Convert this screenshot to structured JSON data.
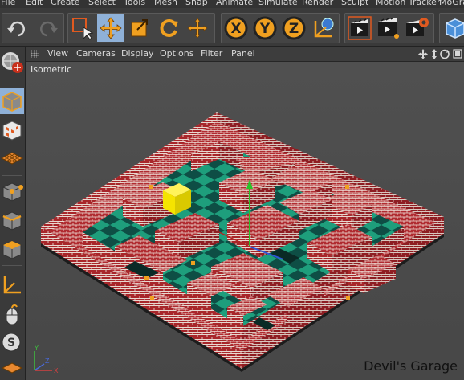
{
  "menubar": {
    "items": [
      "File",
      "Edit",
      "Create",
      "Select",
      "Tools",
      "Mesh",
      "Snap",
      "Animate",
      "Simulate",
      "Render",
      "Sculpt",
      "Motion Tracker",
      "MoGraph"
    ]
  },
  "toolbar": {
    "buttons": [
      "undo-icon",
      "redo-icon",
      "live-selection-icon",
      "move-icon",
      "scale-icon",
      "rotate-icon",
      "recent-tools-icon",
      "x-axis-lock-icon",
      "y-axis-lock-icon",
      "z-axis-lock-icon",
      "coordinate-system-icon",
      "render-view-icon",
      "render-to-picture-viewer-icon",
      "render-settings-icon",
      "cube-object-icon"
    ],
    "x_label": "X",
    "y_label": "Y",
    "z_label": "Z",
    "selected": "move-icon"
  },
  "left_palette": {
    "buttons": [
      "make-editable-icon",
      "model-mode-icon",
      "texture-mode-icon",
      "workplane-mode-icon",
      "points-mode-icon",
      "edges-mode-icon",
      "polygons-mode-icon",
      "axis-mode-icon",
      "tweak-mode-icon",
      "snapping-icon",
      "workplane-lock-icon"
    ],
    "selected": "model-mode-icon"
  },
  "viewport": {
    "menu": [
      "View",
      "Cameras",
      "Display",
      "Options",
      "Filter",
      "Panel"
    ],
    "camera_label": "Isometric",
    "watermark": "Devil's Garage",
    "axis_labels": {
      "x": "X",
      "y": "Y",
      "z": "Z"
    }
  },
  "colors": {
    "brick": "#a8262a",
    "mortar": "#e8d8d0",
    "floor_teal": "#1e9e7c",
    "floor_dark": "#0e4e45",
    "yellow_block": "#f5e400",
    "viewport_bg": "#4c4c4c",
    "selection_blue": "#8fb1d8"
  }
}
